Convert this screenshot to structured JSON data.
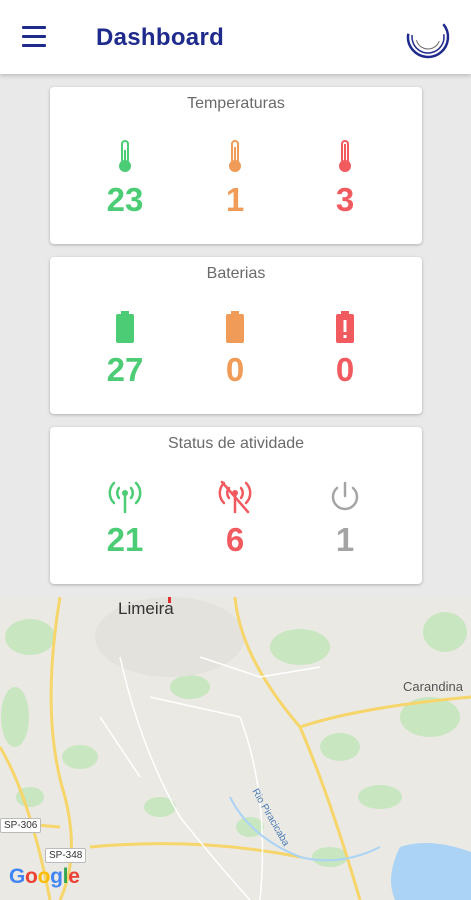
{
  "header": {
    "title": "Dashboard",
    "menu_icon": "menu-icon",
    "logo_icon": "crescent-logo-icon"
  },
  "cards": [
    {
      "title": "Temperaturas",
      "metrics": [
        {
          "icon": "thermometer-icon",
          "value": "23",
          "color": "#4ccc74"
        },
        {
          "icon": "thermometer-icon",
          "value": "1",
          "color": "#f09b57"
        },
        {
          "icon": "thermometer-icon",
          "value": "3",
          "color": "#f15a5e"
        }
      ]
    },
    {
      "title": "Baterias",
      "metrics": [
        {
          "icon": "battery-full-icon",
          "value": "27",
          "color": "#4ccc74"
        },
        {
          "icon": "battery-half-icon",
          "value": "0",
          "color": "#f09b57"
        },
        {
          "icon": "battery-alert-icon",
          "value": "0",
          "color": "#f15a5e"
        }
      ]
    },
    {
      "title": "Status de atividade",
      "metrics": [
        {
          "icon": "signal-icon",
          "value": "21",
          "color": "#4ccc74"
        },
        {
          "icon": "signal-off-icon",
          "value": "6",
          "color": "#f15a5e"
        },
        {
          "icon": "power-icon",
          "value": "1",
          "color": "#a4a4a4"
        }
      ]
    }
  ],
  "map": {
    "city_label": "Limeira",
    "town_label": "Carandina",
    "river_label": "Rio Piracicaba",
    "road_labels": [
      "SP-306",
      "SP-348"
    ],
    "provider": "Google"
  }
}
